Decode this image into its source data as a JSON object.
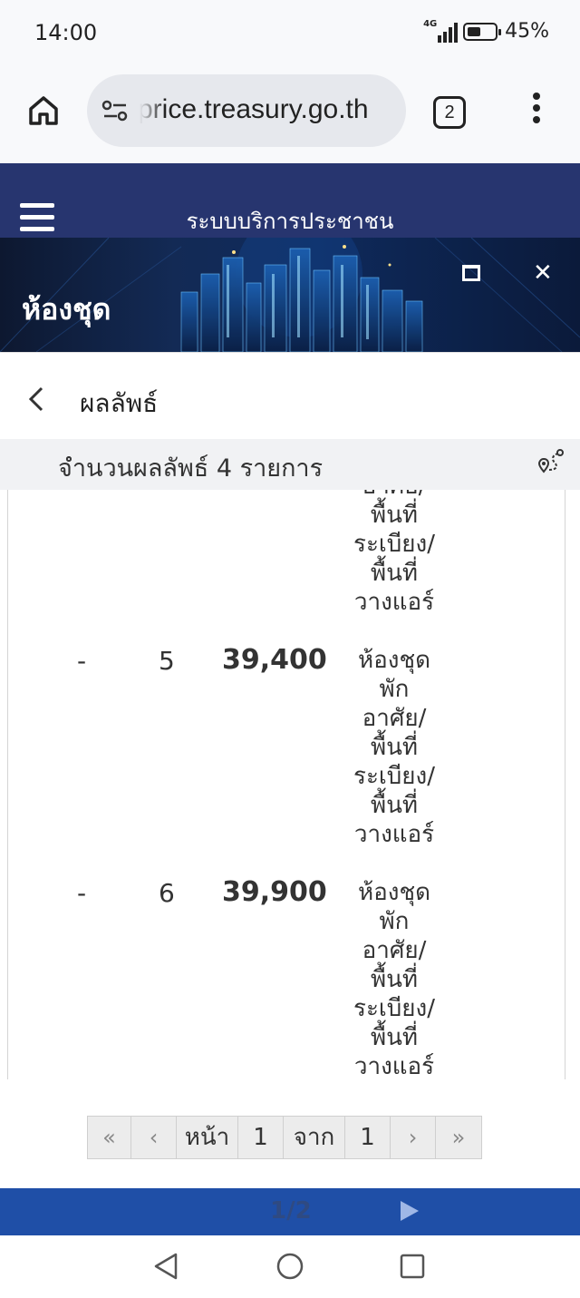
{
  "status": {
    "time": "14:00",
    "network": "4G",
    "battery": "45%"
  },
  "browser": {
    "url": "price.treasury.go.th",
    "tab_count": "2"
  },
  "app": {
    "title": "ระบบบริการประชาชน",
    "banner_title": "ห้องชุด"
  },
  "result": {
    "title": "ผลลัพธ์",
    "count_text": "จำนวนผลลัพธ์ 4 รายการ"
  },
  "rows": [
    {
      "dash": "",
      "num": "",
      "price": "",
      "type": [
        "อาศัย/",
        "พื้นที่",
        "ระเบียง/",
        "พื้นที่",
        "วางแอร์"
      ]
    },
    {
      "dash": "-",
      "num": "5",
      "price": "39,400",
      "type": [
        "ห้องชุด",
        "พัก",
        "อาศัย/",
        "พื้นที่",
        "ระเบียง/",
        "พื้นที่",
        "วางแอร์"
      ]
    },
    {
      "dash": "-",
      "num": "6",
      "price": "39,900",
      "type": [
        "ห้องชุด",
        "พัก",
        "อาศัย/",
        "พื้นที่",
        "ระเบียง/",
        "พื้นที่",
        "วางแอร์"
      ]
    }
  ],
  "pagination": {
    "first": "«",
    "prev": "‹",
    "page_label": "หน้า",
    "current": "1",
    "of_label": "จาก",
    "total": "1",
    "next": "›",
    "last": "»"
  },
  "viewer": {
    "page_indicator": "1/2"
  },
  "colors": {
    "header": "#27356f",
    "bottom_bar": "#1f4fa7"
  }
}
